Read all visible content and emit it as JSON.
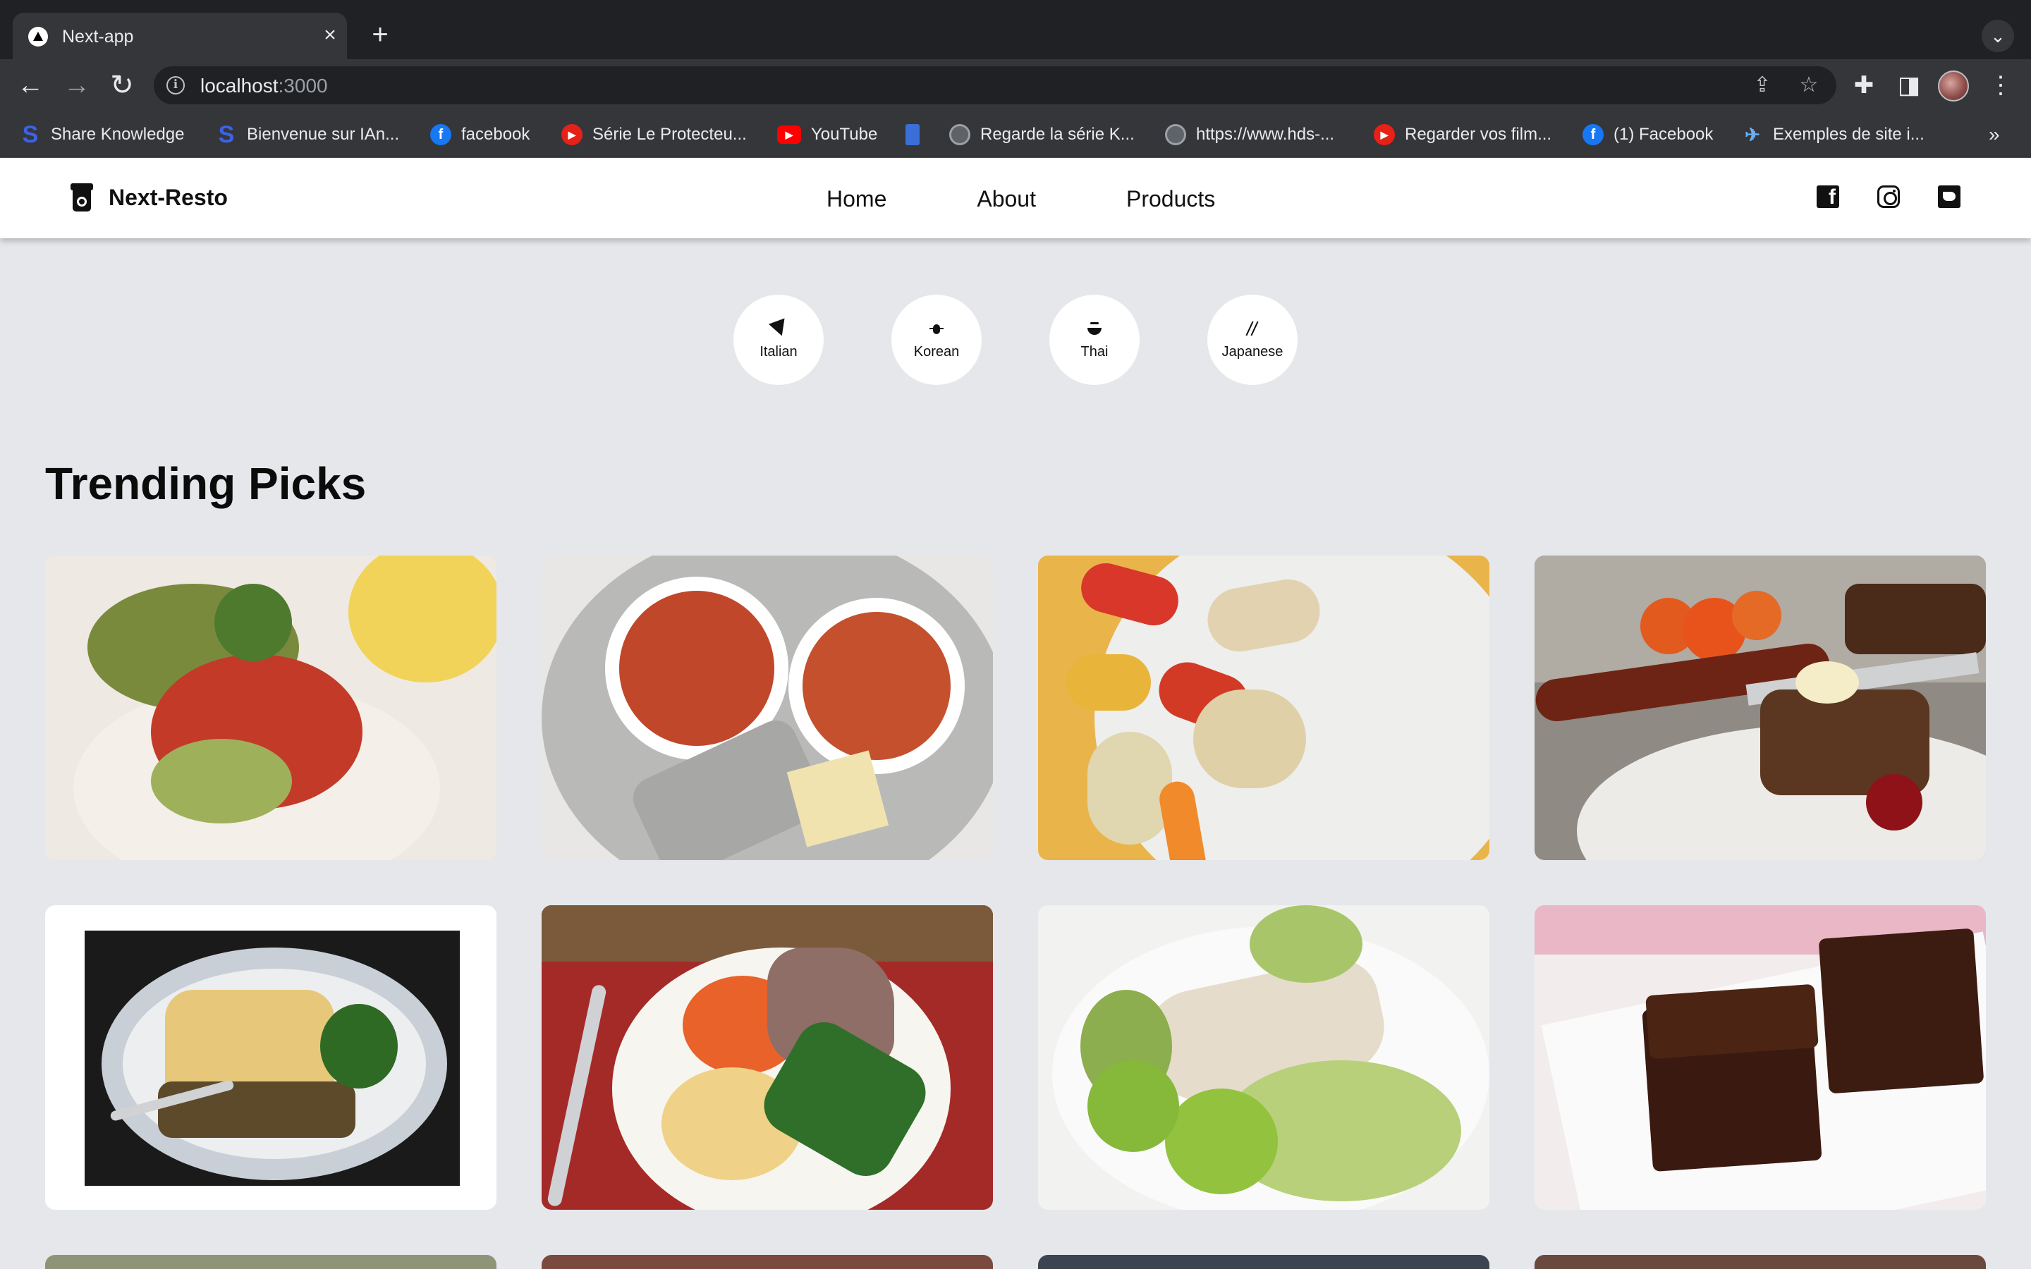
{
  "browser": {
    "tab_title": "Next-app",
    "url_host": "localhost",
    "url_port": ":3000",
    "bookmarks": [
      {
        "label": "Share Knowledge",
        "icon": "s-logo-icon"
      },
      {
        "label": "Bienvenue sur IAn...",
        "icon": "s-logo-icon"
      },
      {
        "label": "facebook",
        "icon": "facebook-icon"
      },
      {
        "label": "Série Le Protecteu...",
        "icon": "play-icon"
      },
      {
        "label": "YouTube",
        "icon": "youtube-icon"
      },
      {
        "label": "",
        "icon": "bookmark-icon"
      },
      {
        "label": "Regarde la série K...",
        "icon": "globe-icon"
      },
      {
        "label": "https://www.hds-...",
        "icon": "globe-icon"
      },
      {
        "label": "Regarder vos film...",
        "icon": "play-icon"
      },
      {
        "label": "(1) Facebook",
        "icon": "facebook-icon"
      },
      {
        "label": "Exemples de site i...",
        "icon": "plane-icon"
      }
    ],
    "more_label": "»"
  },
  "navbar": {
    "brand": "Next-Resto",
    "links": [
      "Home",
      "About",
      "Products"
    ]
  },
  "categories": [
    {
      "label": "Italian",
      "icon": "pizza-icon"
    },
    {
      "label": "Korean",
      "icon": "bug-icon"
    },
    {
      "label": "Thai",
      "icon": "bowl-icon"
    },
    {
      "label": "Japanese",
      "icon": "chopsticks-icon"
    }
  ],
  "section": {
    "title": "Trending Picks"
  },
  "dishes": [
    {
      "name": "dish-fish-tomato"
    },
    {
      "name": "dish-soup-bowls"
    },
    {
      "name": "dish-stuffed-peppers"
    },
    {
      "name": "dish-banana-bread"
    },
    {
      "name": "dish-shepherds-pie"
    },
    {
      "name": "dish-roast-beef-plate"
    },
    {
      "name": "dish-halibut-salad"
    },
    {
      "name": "dish-brownies"
    }
  ],
  "colors": {
    "page_bg": "#e5e7eb",
    "chrome_dark": "#202124",
    "chrome_mid": "#35363a",
    "text_dark": "#111111"
  }
}
